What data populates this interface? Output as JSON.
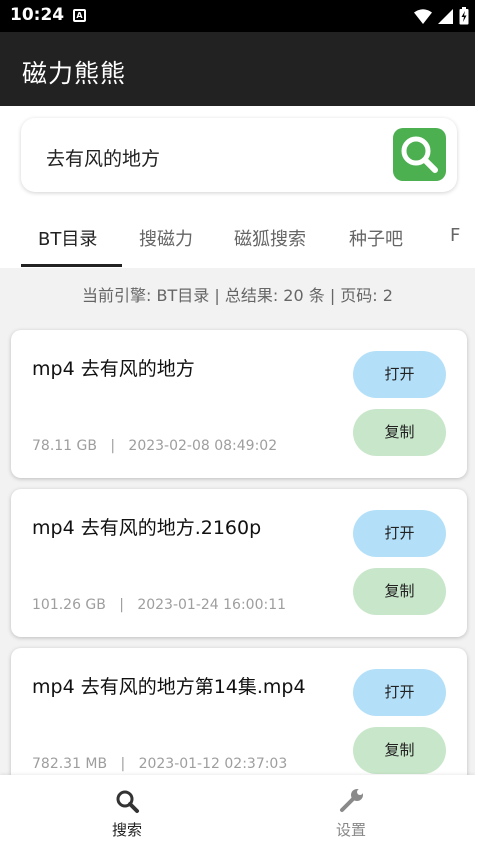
{
  "status_bar": {
    "time": "10:24",
    "notification_badge": "A"
  },
  "app": {
    "title": "磁力熊熊"
  },
  "search": {
    "query": "去有风的地方"
  },
  "tabs": [
    {
      "label": "BT目录",
      "active": true
    },
    {
      "label": "搜磁力",
      "active": false
    },
    {
      "label": "磁狐搜索",
      "active": false
    },
    {
      "label": "种子吧",
      "active": false
    },
    {
      "label": "F",
      "active": false
    }
  ],
  "summary": "当前引擎: BT目录 | 总结果: 20 条 | 页码: 2",
  "results": [
    {
      "title": "mp4 去有风的地方",
      "size": "78.11 GB",
      "date": "2023-02-08 08:49:02",
      "open_label": "打开",
      "copy_label": "复制"
    },
    {
      "title": "mp4 去有风的地方.2160p",
      "size": "101.26 GB",
      "date": "2023-01-24 16:00:11",
      "open_label": "打开",
      "copy_label": "复制"
    },
    {
      "title": "mp4 去有风的地方第14集.mp4",
      "size": "782.31 MB",
      "date": "2023-01-12 02:37:03",
      "open_label": "打开",
      "copy_label": "复制"
    }
  ],
  "meta_separator": "|",
  "bottom_nav": [
    {
      "label": "搜索",
      "icon": "search-icon",
      "active": true
    },
    {
      "label": "设置",
      "icon": "wrench-icon",
      "active": false
    }
  ],
  "colors": {
    "appbar": "#222222",
    "search_button": "#4caf50",
    "open_button": "#b3e0f8",
    "copy_button": "#c8e6c9"
  }
}
